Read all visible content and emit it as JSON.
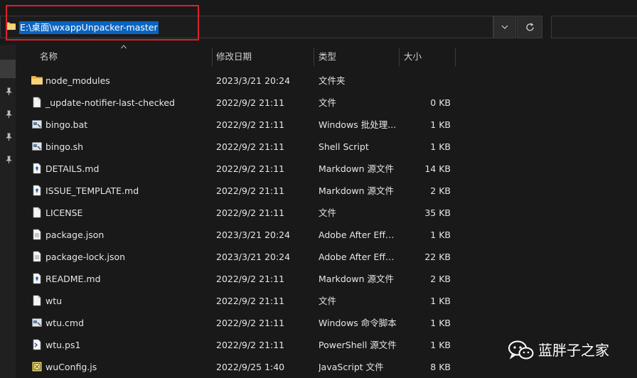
{
  "address_bar": {
    "path": "E:\\桌面\\wxappUnpacker-master"
  },
  "header": {
    "name": "名称",
    "date": "修改日期",
    "type": "类型",
    "size": "大小"
  },
  "files": [
    {
      "name": "node_modules",
      "date": "2023/3/21 20:24",
      "type": "文件夹",
      "size": "",
      "icon": "folder-icon"
    },
    {
      "name": "_update-notifier-last-checked",
      "date": "2022/9/2 21:11",
      "type": "文件",
      "size": "0 KB",
      "icon": "file-icon"
    },
    {
      "name": "bingo.bat",
      "date": "2022/9/2 21:11",
      "type": "Windows 批处理...",
      "size": "1 KB",
      "icon": "bat-file-icon"
    },
    {
      "name": "bingo.sh",
      "date": "2022/9/2 21:11",
      "type": "Shell Script",
      "size": "1 KB",
      "icon": "shell-file-icon"
    },
    {
      "name": "DETAILS.md",
      "date": "2022/9/2 21:11",
      "type": "Markdown 源文件",
      "size": "14 KB",
      "icon": "markdown-file-icon"
    },
    {
      "name": "ISSUE_TEMPLATE.md",
      "date": "2022/9/2 21:11",
      "type": "Markdown 源文件",
      "size": "2 KB",
      "icon": "markdown-file-icon"
    },
    {
      "name": "LICENSE",
      "date": "2022/9/2 21:11",
      "type": "文件",
      "size": "35 KB",
      "icon": "file-icon"
    },
    {
      "name": "package.json",
      "date": "2023/3/21 20:24",
      "type": "Adobe After Effe...",
      "size": "1 KB",
      "icon": "json-file-icon"
    },
    {
      "name": "package-lock.json",
      "date": "2023/3/21 20:24",
      "type": "Adobe After Effe...",
      "size": "22 KB",
      "icon": "json-file-icon"
    },
    {
      "name": "README.md",
      "date": "2022/9/2 21:11",
      "type": "Markdown 源文件",
      "size": "2 KB",
      "icon": "markdown-file-icon"
    },
    {
      "name": "wtu",
      "date": "2022/9/2 21:11",
      "type": "文件",
      "size": "1 KB",
      "icon": "file-icon"
    },
    {
      "name": "wtu.cmd",
      "date": "2022/9/2 21:11",
      "type": "Windows 命令脚本",
      "size": "1 KB",
      "icon": "cmd-file-icon"
    },
    {
      "name": "wtu.ps1",
      "date": "2022/9/2 21:11",
      "type": "PowerShell 源文件",
      "size": "1 KB",
      "icon": "powershell-file-icon"
    },
    {
      "name": "wuConfig.js",
      "date": "2022/9/25 1:40",
      "type": "JavaScript 文件",
      "size": "8 KB",
      "icon": "javascript-file-icon"
    }
  ],
  "watermark": {
    "text": "蓝胖子之家"
  },
  "colors": {
    "background": "#191919",
    "selection": "#0a64c0",
    "highlight_box": "#e0202a",
    "folder": "#f2c55c"
  }
}
